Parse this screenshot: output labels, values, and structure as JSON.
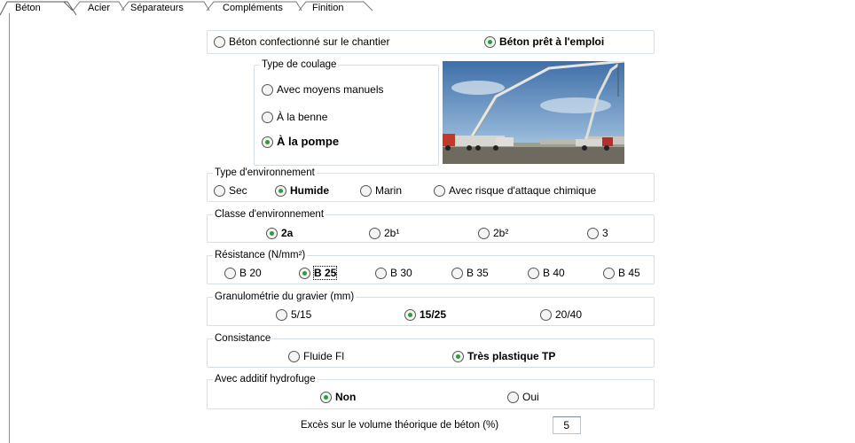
{
  "tabs": [
    "Béton",
    "Acier",
    "Séparateurs",
    "Compléments",
    "Finition"
  ],
  "mode": {
    "options": [
      "Béton confectionné sur le chantier",
      "Béton prêt à l'emploi"
    ],
    "selected": 1
  },
  "coulage": {
    "legend": "Type de coulage",
    "options": [
      "Avec moyens manuels",
      "À la benne",
      "À la pompe"
    ],
    "selected": 2
  },
  "image": {
    "description_icon": "concrete-pump-truck-photo"
  },
  "environnement": {
    "legend": "Type d'environnement",
    "options": [
      "Sec",
      "Humide",
      "Marin",
      "Avec risque d'attaque chimique"
    ],
    "selected": 1
  },
  "classe": {
    "legend": "Classe d'environnement",
    "options": [
      "2a",
      "2b¹",
      "2b²",
      "3"
    ],
    "selected": 0
  },
  "resistance": {
    "legend": "Résistance (N/mm²)",
    "options": [
      "B 20",
      "B 25",
      "B 30",
      "B 35",
      "B 40",
      "B 45"
    ],
    "selected": 1
  },
  "granulometrie": {
    "legend": "Granulométrie du gravier (mm)",
    "options": [
      "5/15",
      "15/25",
      "20/40"
    ],
    "selected": 1
  },
  "consistance": {
    "legend": "Consistance",
    "options": [
      "Fluide Fl",
      "Très plastique TP"
    ],
    "selected": 1
  },
  "hydrofuge": {
    "legend": "Avec additif hydrofuge",
    "options": [
      "Non",
      "Oui"
    ],
    "selected": 0
  },
  "excess": {
    "label": "Excès sur le volume théorique de béton (%)",
    "value": "5"
  },
  "colors": {
    "group_border": "#d5dfe5",
    "radio_dot": "#2a9d3a"
  }
}
